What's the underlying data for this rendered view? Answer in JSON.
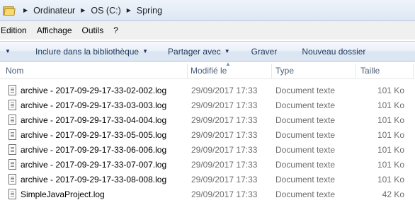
{
  "address": {
    "folder_icon": "folder-icon",
    "crumbs": [
      "Ordinateur",
      "OS (C:)",
      "Spring"
    ]
  },
  "menu": [
    "Edition",
    "Affichage",
    "Outils",
    "?"
  ],
  "toolbar": {
    "include_label": "Inclure dans la bibliothèque",
    "share_label": "Partager avec",
    "burn_label": "Graver",
    "new_folder_label": "Nouveau dossier"
  },
  "columns": {
    "name": "Nom",
    "modified": "Modifié le",
    "type": "Type",
    "size": "Taille"
  },
  "files": [
    {
      "name": "archive - 2017-09-29-17-33-02-002.log",
      "modified": "29/09/2017 17:33",
      "type": "Document texte",
      "size": "101 Ko"
    },
    {
      "name": "archive - 2017-09-29-17-33-03-003.log",
      "modified": "29/09/2017 17:33",
      "type": "Document texte",
      "size": "101 Ko"
    },
    {
      "name": "archive - 2017-09-29-17-33-04-004.log",
      "modified": "29/09/2017 17:33",
      "type": "Document texte",
      "size": "101 Ko"
    },
    {
      "name": "archive - 2017-09-29-17-33-05-005.log",
      "modified": "29/09/2017 17:33",
      "type": "Document texte",
      "size": "101 Ko"
    },
    {
      "name": "archive - 2017-09-29-17-33-06-006.log",
      "modified": "29/09/2017 17:33",
      "type": "Document texte",
      "size": "101 Ko"
    },
    {
      "name": "archive - 2017-09-29-17-33-07-007.log",
      "modified": "29/09/2017 17:33",
      "type": "Document texte",
      "size": "101 Ko"
    },
    {
      "name": "archive - 2017-09-29-17-33-08-008.log",
      "modified": "29/09/2017 17:33",
      "type": "Document texte",
      "size": "101 Ko"
    },
    {
      "name": "SimpleJavaProject.log",
      "modified": "29/09/2017 17:33",
      "type": "Document texte",
      "size": "42 Ko"
    }
  ]
}
